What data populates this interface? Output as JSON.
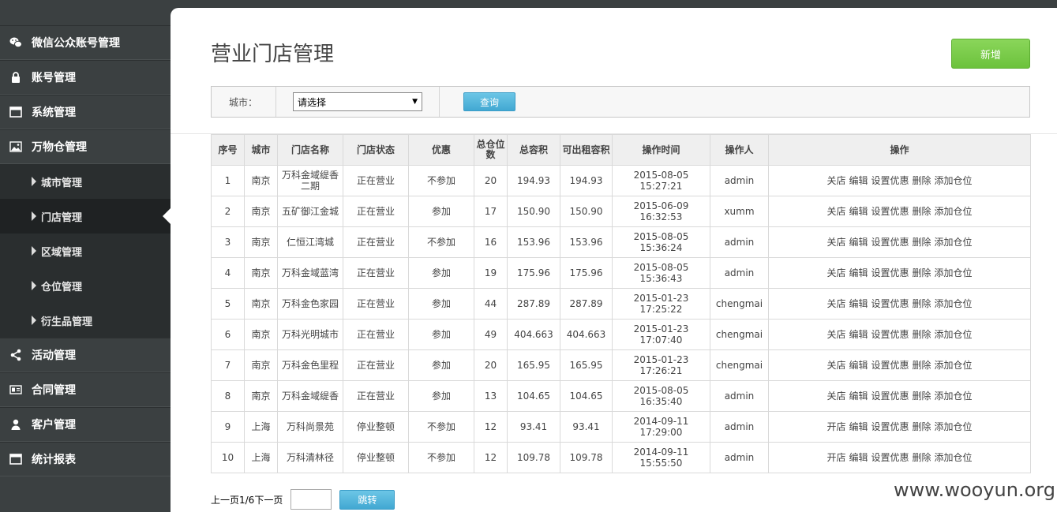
{
  "sidebar": {
    "items": [
      {
        "label": "微信公众账号管理",
        "icon": "wechat-icon"
      },
      {
        "label": "账号管理",
        "icon": "lock-icon"
      },
      {
        "label": "系统管理",
        "icon": "window-icon"
      },
      {
        "label": "万物仓管理",
        "icon": "photo-icon"
      }
    ],
    "sub_items": [
      {
        "label": "城市管理"
      },
      {
        "label": "门店管理"
      },
      {
        "label": "区域管理"
      },
      {
        "label": "仓位管理"
      },
      {
        "label": "衍生品管理"
      }
    ],
    "items_after": [
      {
        "label": "活动管理",
        "icon": "share-icon"
      },
      {
        "label": "合同管理",
        "icon": "id-card-icon"
      },
      {
        "label": "客户管理",
        "icon": "user-icon"
      },
      {
        "label": "统计报表",
        "icon": "window-icon"
      }
    ],
    "active_sub": "门店管理"
  },
  "page": {
    "title": "营业门店管理",
    "add_label": "新增"
  },
  "filter": {
    "city_label": "城市：",
    "city_value": "请选择",
    "query_label": "查询"
  },
  "table": {
    "headers": [
      "序号",
      "城市",
      "门店名称",
      "门店状态",
      "优惠",
      "总仓位数",
      "总容积",
      "可出租容积",
      "操作时间",
      "操作人",
      "操作"
    ],
    "rows": [
      {
        "no": "1",
        "city": "南京",
        "name": "万科金域缇香二期",
        "status": "正在营业",
        "promo": "不参加",
        "slots": "20",
        "volume": "194.93",
        "rentable": "194.93",
        "date": "2015-08-05",
        "time": "15:27:21",
        "operator": "admin",
        "toggle": "关店"
      },
      {
        "no": "2",
        "city": "南京",
        "name": "五矿御江金城",
        "status": "正在营业",
        "promo": "参加",
        "slots": "17",
        "volume": "150.90",
        "rentable": "150.90",
        "date": "2015-06-09",
        "time": "16:32:53",
        "operator": "xumm",
        "toggle": "关店"
      },
      {
        "no": "3",
        "city": "南京",
        "name": "仁恒江湾城",
        "status": "正在营业",
        "promo": "不参加",
        "slots": "16",
        "volume": "153.96",
        "rentable": "153.96",
        "date": "2015-08-05",
        "time": "15:36:24",
        "operator": "admin",
        "toggle": "关店"
      },
      {
        "no": "4",
        "city": "南京",
        "name": "万科金域蓝湾",
        "status": "正在营业",
        "promo": "参加",
        "slots": "19",
        "volume": "175.96",
        "rentable": "175.96",
        "date": "2015-08-05",
        "time": "15:36:43",
        "operator": "admin",
        "toggle": "关店"
      },
      {
        "no": "5",
        "city": "南京",
        "name": "万科金色家园",
        "status": "正在营业",
        "promo": "参加",
        "slots": "44",
        "volume": "287.89",
        "rentable": "287.89",
        "date": "2015-01-23",
        "time": "17:25:22",
        "operator": "chengmai",
        "toggle": "关店"
      },
      {
        "no": "6",
        "city": "南京",
        "name": "万科光明城市",
        "status": "正在营业",
        "promo": "参加",
        "slots": "49",
        "volume": "404.663",
        "rentable": "404.663",
        "date": "2015-01-23",
        "time": "17:07:40",
        "operator": "chengmai",
        "toggle": "关店"
      },
      {
        "no": "7",
        "city": "南京",
        "name": "万科金色里程",
        "status": "正在营业",
        "promo": "参加",
        "slots": "20",
        "volume": "165.95",
        "rentable": "165.95",
        "date": "2015-01-23",
        "time": "17:26:21",
        "operator": "chengmai",
        "toggle": "关店"
      },
      {
        "no": "8",
        "city": "南京",
        "name": "万科金域缇香",
        "status": "正在营业",
        "promo": "参加",
        "slots": "13",
        "volume": "104.65",
        "rentable": "104.65",
        "date": "2015-08-05",
        "time": "16:35:40",
        "operator": "admin",
        "toggle": "关店"
      },
      {
        "no": "9",
        "city": "上海",
        "name": "万科尚景苑",
        "status": "停业整顿",
        "promo": "不参加",
        "slots": "12",
        "volume": "93.41",
        "rentable": "93.41",
        "date": "2014-09-11",
        "time": "17:29:00",
        "operator": "admin",
        "toggle": "开店"
      },
      {
        "no": "10",
        "city": "上海",
        "name": "万科清林径",
        "status": "停业整顿",
        "promo": "不参加",
        "slots": "12",
        "volume": "109.78",
        "rentable": "109.78",
        "date": "2014-09-11",
        "time": "15:55:50",
        "operator": "admin",
        "toggle": "开店"
      }
    ],
    "actions": [
      "编辑",
      "设置优惠",
      "删除",
      "添加仓位"
    ]
  },
  "pager": {
    "text": "上一页1/6下一页",
    "jump_label": "跳转"
  },
  "watermark": "www.wooyun.org"
}
